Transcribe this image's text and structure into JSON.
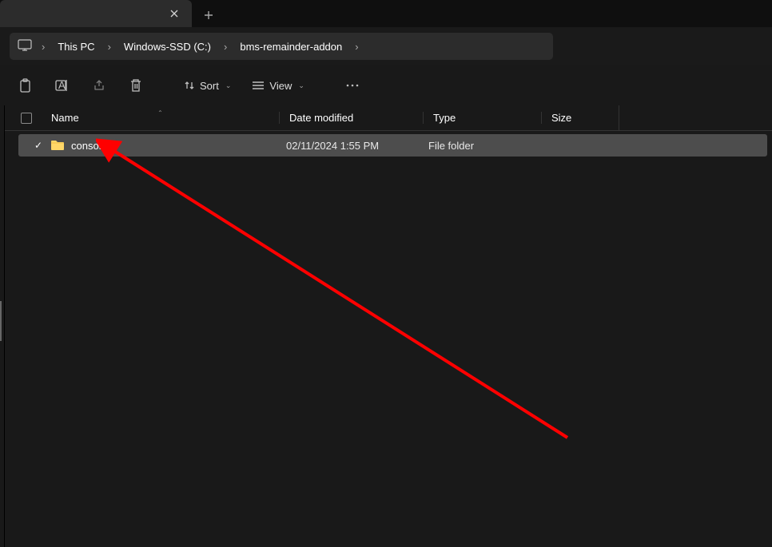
{
  "tabs": {
    "active": {
      "title": "",
      "close_label": "✕"
    },
    "new_tab_glyph": "+"
  },
  "breadcrumbs": {
    "items": [
      {
        "label": "This PC"
      },
      {
        "label": "Windows-SSD (C:)"
      },
      {
        "label": "bms-remainder-addon"
      }
    ],
    "separator": "›"
  },
  "toolbar": {
    "sort_label": "Sort",
    "view_label": "View"
  },
  "columns": {
    "name": "Name",
    "date_modified": "Date modified",
    "type": "Type",
    "size": "Size"
  },
  "rows": [
    {
      "selected": true,
      "name": "console",
      "date_modified": "02/11/2024 1:55 PM",
      "type": "File folder",
      "size": ""
    }
  ]
}
